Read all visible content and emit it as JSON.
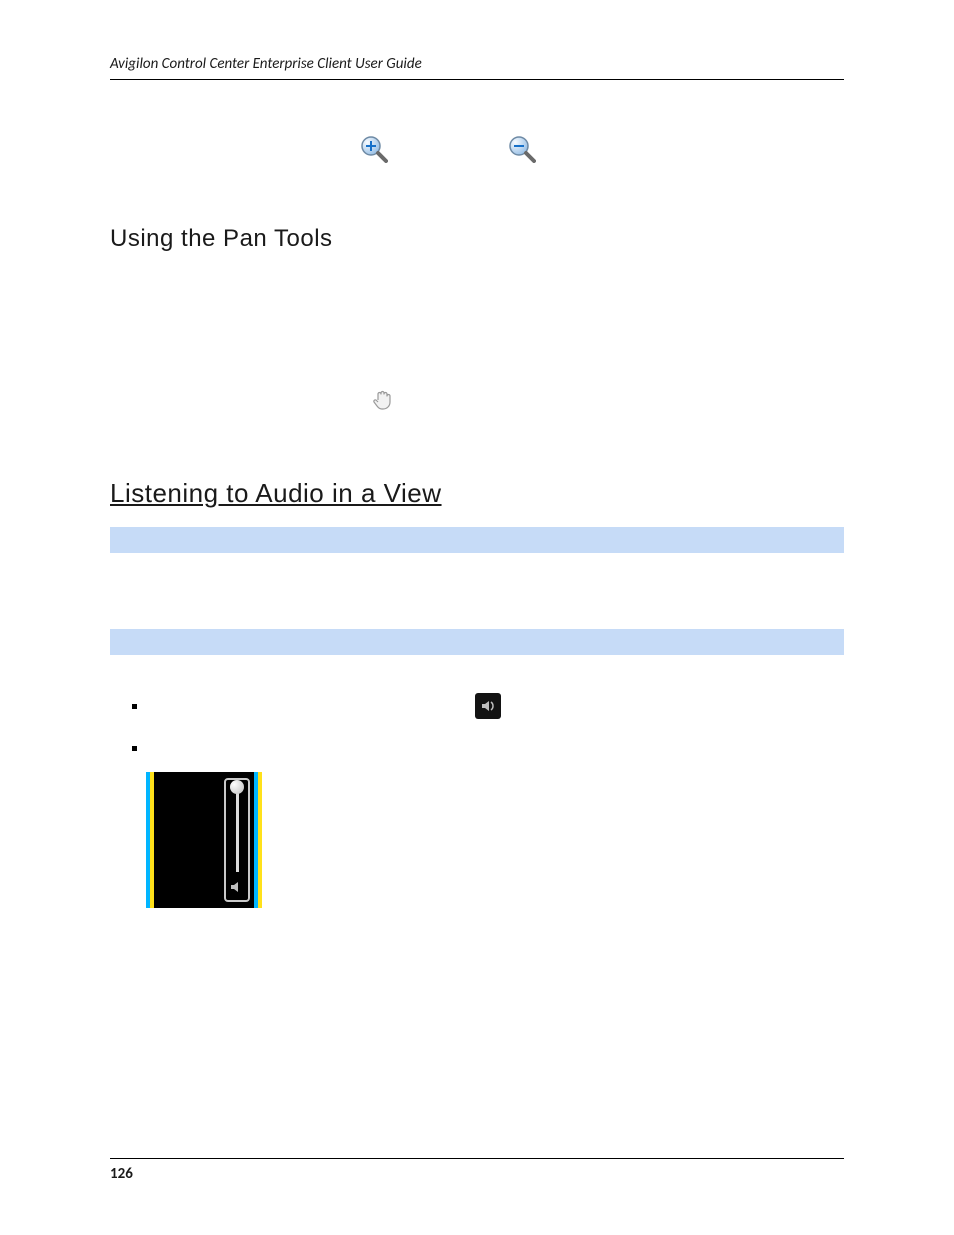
{
  "header": {
    "running": "Avigilon Control Center Enterprise Client User Guide"
  },
  "icons": {
    "zoom_in": "zoom-in-icon",
    "zoom_out": "zoom-out-icon",
    "pan_hand": "pan-hand-icon",
    "speaker": "speaker-icon",
    "slider": "volume-slider"
  },
  "sections": {
    "pan_title": "Using the Pan Tools",
    "audio_title": "Listening to Audio in a View"
  },
  "footer": {
    "page_number": "126"
  }
}
